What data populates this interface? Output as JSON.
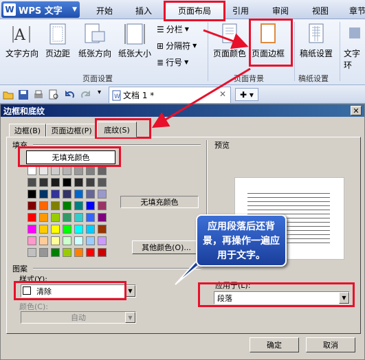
{
  "app": {
    "name": "WPS 文字"
  },
  "tabs": [
    "开始",
    "插入",
    "页面布局",
    "引用",
    "审阅",
    "视图",
    "章节"
  ],
  "ribbon": {
    "buttons": {
      "text_direction": "文字方向",
      "margins": "页边距",
      "orientation": "纸张方向",
      "size": "纸张大小",
      "page_color": "页面颜色",
      "page_border": "页面边框",
      "manuscript": "稿纸设置",
      "text_wrap": "文字环"
    },
    "small": {
      "columns": "分栏",
      "separator": "分隔符",
      "line_numbers": "行号"
    },
    "groups": {
      "page_setup": "页面设置",
      "page_bg": "页面背景",
      "manuscript": "稿纸设置"
    }
  },
  "document_tab": {
    "title": "文档 1 *"
  },
  "dialog": {
    "title": "边框和底纹",
    "tabs": [
      "边框(B)",
      "页面边框(P)",
      "底纹(S)"
    ],
    "fill_label": "填充",
    "no_fill": "无填充颜色",
    "current_color": "无填充颜色",
    "more_colors": "其他颜色(O)...",
    "pattern_label": "图案",
    "style_label": "样式(Y):",
    "style_value": "清除",
    "color_label": "颜色(C):",
    "color_value": "自动",
    "preview_label": "预览",
    "apply_label": "应用于(L):",
    "apply_value": "段落",
    "ok": "确定",
    "cancel": "取消"
  },
  "callout": {
    "text": "应用段落后还背景，再操作一遍应用于文字。"
  },
  "swatches": [
    [
      "#ffffff",
      "#e6e6e6",
      "#cccccc",
      "#b3b3b3",
      "#999999",
      "#808080",
      "#666666"
    ],
    [
      "#4d4d4d",
      "#333333",
      "#1a1a1a",
      "#000000",
      "#262626",
      "#404040",
      "#595959"
    ],
    [
      "#000000",
      "#003366",
      "#333399",
      "#333366",
      "#0066cc",
      "#666699",
      "#9999cc"
    ],
    [
      "#800000",
      "#ff6600",
      "#808000",
      "#008000",
      "#008080",
      "#0000ff",
      "#993366"
    ],
    [
      "#ff0000",
      "#ff9900",
      "#99cc00",
      "#339966",
      "#33cccc",
      "#3366ff",
      "#800080"
    ],
    [
      "#ff00ff",
      "#ffcc00",
      "#ffff00",
      "#00ff00",
      "#00ffff",
      "#00ccff",
      "#993300"
    ],
    [
      "#ff99cc",
      "#ffcc99",
      "#ffff99",
      "#ccffcc",
      "#ccffff",
      "#99ccff",
      "#cc99ff"
    ],
    [
      "#c0c0c0",
      "#969696",
      "#008000",
      "#99cc00",
      "#ff8000",
      "#ff0000",
      "#cc0000"
    ]
  ]
}
